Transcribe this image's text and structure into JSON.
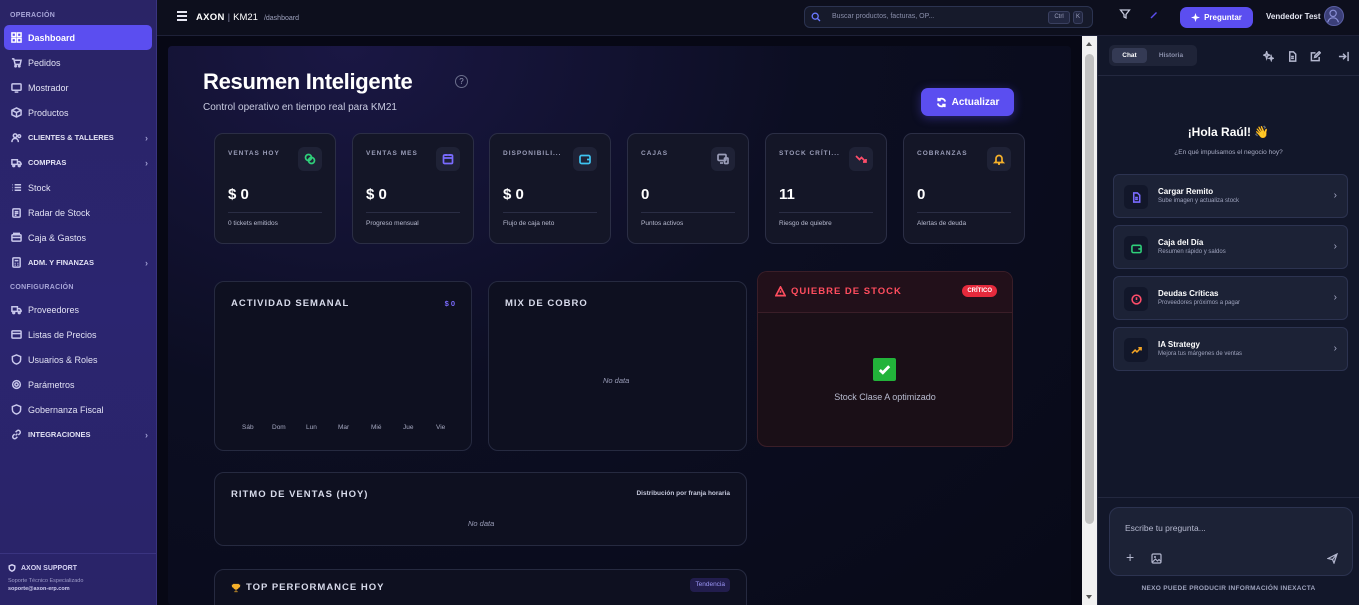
{
  "sidebar": {
    "section_operacion": "OPERACIÓN",
    "section_config": "CONFIGURACIÓN",
    "items": [
      {
        "label": "Dashboard"
      },
      {
        "label": "Pedidos"
      },
      {
        "label": "Mostrador"
      },
      {
        "label": "Productos"
      },
      {
        "label": "CLIENTES & TALLERES"
      },
      {
        "label": "COMPRAS"
      },
      {
        "label": "Stock"
      },
      {
        "label": "Radar de Stock"
      },
      {
        "label": "Caja & Gastos"
      },
      {
        "label": "ADM. Y FINANZAS"
      }
    ],
    "config_items": [
      {
        "label": "Proveedores"
      },
      {
        "label": "Listas de Precios"
      },
      {
        "label": "Usuarios & Roles"
      },
      {
        "label": "Parámetros"
      },
      {
        "label": "Gobernanza Fiscal"
      },
      {
        "label": "INTEGRACIONES"
      }
    ],
    "support": {
      "title": "AXON SUPPORT",
      "subtitle": "Soporte Técnico Especializado",
      "email": "soporte@axon-erp.com"
    }
  },
  "topbar": {
    "brand": "AXON",
    "company": "KM21",
    "breadcrumb": "/dashboard",
    "search_placeholder": "Buscar productos, facturas, OP...",
    "kbd_ctrl": "Ctrl",
    "kbd_k": "K",
    "ask_label": "Preguntar",
    "user_name": "Vendedor Test"
  },
  "dashboard": {
    "title": "Resumen Inteligente",
    "help": "?",
    "subtitle": "Control operativo en tiempo real para KM21",
    "refresh_label": "Actualizar",
    "kpis": [
      {
        "label": "VENTAS HOY",
        "value": "$ 0",
        "foot": "0 tickets emitidos",
        "icon": "coins-icon",
        "color": "#2fd07a"
      },
      {
        "label": "VENTAS MES",
        "value": "$ 0",
        "foot": "Progreso mensual",
        "icon": "calendar-icon",
        "color": "#7a6bff"
      },
      {
        "label": "DISPONIBILI...",
        "value": "$ 0",
        "foot": "Flujo de caja neto",
        "icon": "wallet-icon",
        "color": "#3ec3f0"
      },
      {
        "label": "CAJAS",
        "value": "0",
        "foot": "Puntos activos",
        "icon": "devices-icon",
        "color": "#9a9db8"
      },
      {
        "label": "STOCK CRÍTI...",
        "value": "11",
        "foot": "Riesgo de quiebre",
        "icon": "trend-down-icon",
        "color": "#ff4d6a"
      },
      {
        "label": "COBRANZAS",
        "value": "0",
        "foot": "Alertas de deuda",
        "icon": "bell-icon",
        "color": "#f5b02a"
      }
    ],
    "actividad": {
      "title": "ACTIVIDAD SEMANAL",
      "total": "$ 0",
      "days": [
        "Sáb",
        "Dom",
        "Lun",
        "Mar",
        "Mié",
        "Jue",
        "Vie"
      ]
    },
    "mix": {
      "title": "MIX DE COBRO",
      "empty": "No data"
    },
    "quiebre": {
      "title": "QUIEBRE DE STOCK",
      "badge": "CRÍTICO",
      "message": "Stock Clase A optimizado"
    },
    "ritmo": {
      "title": "RITMO DE VENTAS (HOY)",
      "hint": "Distribución por franja horaria",
      "empty": "No data"
    },
    "top": {
      "title": "TOP PERFORMANCE HOY",
      "badge": "Tendencia"
    }
  },
  "chat": {
    "tab_chat": "Chat",
    "tab_historia": "Historia",
    "greeting": "¡Hola Raúl! 👋",
    "greeting_sub": "¿En qué impulsamos el negocio hoy?",
    "cards": [
      {
        "title": "Cargar Remito",
        "sub": "Sube imagen y actualiza stock",
        "icon": "document-icon",
        "color": "#7a6bff"
      },
      {
        "title": "Caja del Día",
        "sub": "Resumen rápido y saldos",
        "icon": "wallet-icon",
        "color": "#2fd07a"
      },
      {
        "title": "Deudas Críticas",
        "sub": "Proveedores próximos a pagar",
        "icon": "alert-circle-icon",
        "color": "#ff4d6a"
      },
      {
        "title": "IA Strategy",
        "sub": "Mejora tus márgenes de ventas",
        "icon": "trend-up-icon",
        "color": "#f5a524"
      }
    ],
    "input_placeholder": "Escribe tu pregunta...",
    "disclaimer": "NEXO PUEDE PRODUCIR INFORMACIÓN INEXACTA"
  }
}
